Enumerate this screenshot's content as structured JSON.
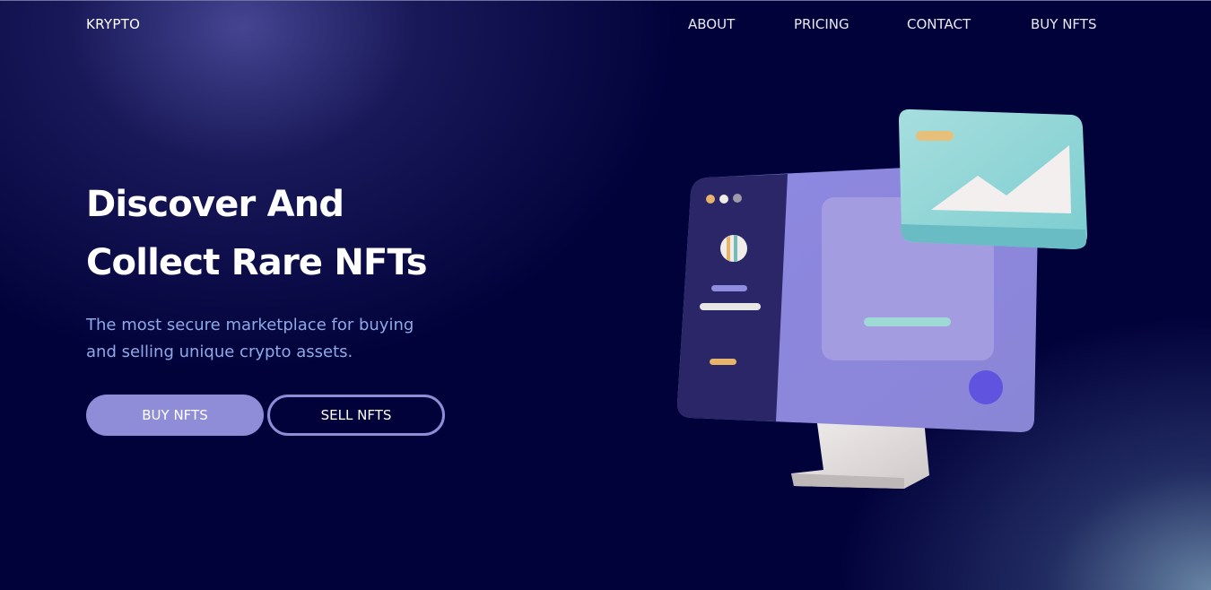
{
  "nav": {
    "logo": "KRYPTO",
    "links": [
      "ABOUT",
      "PRICING",
      "CONTACT",
      "BUY NFTS"
    ]
  },
  "hero": {
    "title_line1": "Discover And",
    "title_line2": "Collect Rare NFTs",
    "subtitle_line1": "The most secure marketplace for buying",
    "subtitle_line2": "and selling unique crypto assets.",
    "primary_button": "BUY NFTS",
    "secondary_button": "SELL NFTS"
  },
  "colors": {
    "background": "#02023b",
    "accent": "#8f8dd7",
    "subtitle": "#8eaae6",
    "teal": "#8fd6d6"
  },
  "icons": {
    "illustration": "computer-monitor-nft-illustration"
  }
}
